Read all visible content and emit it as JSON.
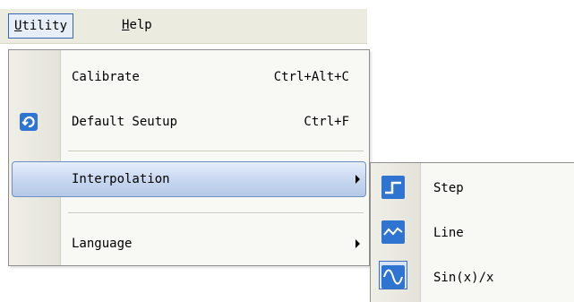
{
  "menubar": {
    "items": [
      {
        "label_u": "U",
        "label_rest": "tility",
        "active": true
      },
      {
        "label_u": "H",
        "label_rest": "elp",
        "active": false
      }
    ]
  },
  "menu": {
    "items": [
      {
        "label": "Calibrate",
        "shortcut": "Ctrl+Alt+C"
      },
      {
        "label": "Default Seutup",
        "shortcut": "Ctrl+F",
        "icon": "reset-icon"
      },
      {
        "label": "Interpolation",
        "submenu": true,
        "highlighted": true
      },
      {
        "label": "Language",
        "submenu": true
      }
    ]
  },
  "submenu": {
    "items": [
      {
        "label": "Step",
        "icon": "step-icon"
      },
      {
        "label": "Line",
        "icon": "line-wave-icon"
      },
      {
        "label": "Sin(x)/x",
        "icon": "sine-wave-icon",
        "checked": true
      }
    ]
  },
  "colors": {
    "icon_blue": "#2f74d0",
    "highlight_border": "#6f8fc4",
    "menubar_bg": "#ecebdf"
  }
}
